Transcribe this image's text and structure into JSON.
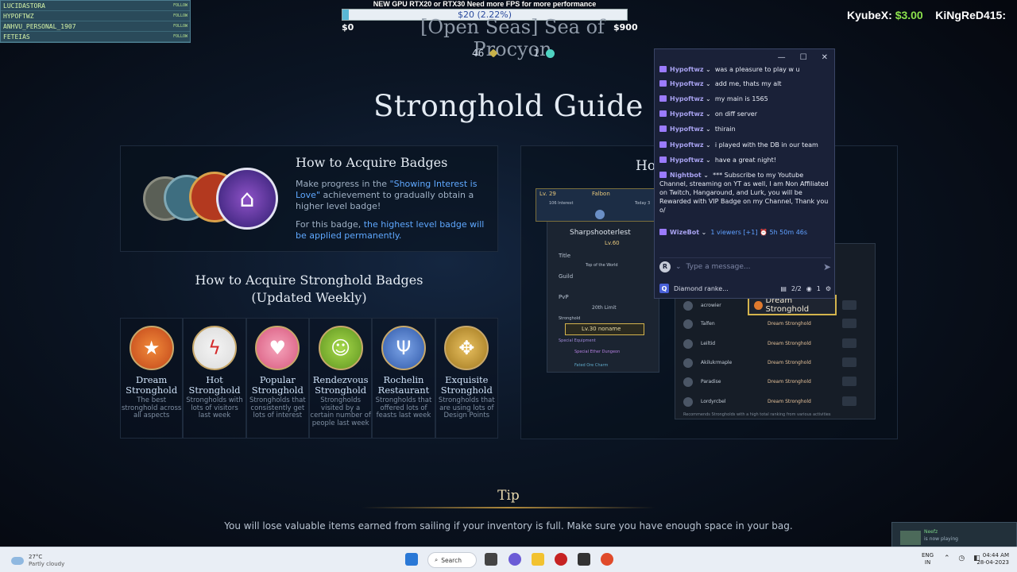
{
  "overlay": {
    "followers": [
      "LUCIDASTORA",
      "HYPOFTWZ",
      "ANHVU_PERSONAL_1907",
      "FETEIAS"
    ],
    "follow_tag": "FOLLOW",
    "goal_text": "NEW GPU RTX20 or RTX30 Need more FPS for more performance",
    "goal_amount": "$20 (2.22%)",
    "goal_progress": 0.0222,
    "goal_min": "$0",
    "goal_max": "$900",
    "donors": [
      {
        "name": "KyubeX:",
        "amount": "$3.00"
      },
      {
        "name": "KiNgReD415:",
        "amount": ""
      }
    ]
  },
  "game": {
    "location": "[Open Seas] Sea of Procyon",
    "currency": {
      "count1": "46",
      "count2": "1"
    },
    "guide_title": "Stronghold Guide",
    "acquire": {
      "title": "How to Acquire Badges",
      "desc_pre": "Make progress in the ",
      "desc_hl": "\"Showing Interest is Love\"",
      "desc_post": " achievement to gradually obtain a higher level badge!",
      "desc2_pre": "For this badge, ",
      "desc2_hl": "the highest level badge will be applied permanently."
    },
    "stronghold_badges_title": "How to Acquire Stronghold Badges",
    "stronghold_badges_subtitle": "(Updated Weekly)",
    "badges": [
      {
        "name": "Dream Stronghold",
        "desc": "The best stronghold across all aspects",
        "icon": "house-star-icon",
        "color": "#d8621e"
      },
      {
        "name": "Hot Stronghold",
        "desc": "Strongholds with lots of visitors last week",
        "icon": "lightning-icon",
        "color": "#cc2b2b"
      },
      {
        "name": "Popular Stronghold",
        "desc": "Strongholds that consistently get lots of interest",
        "icon": "heart-icon",
        "color": "#e06a8c"
      },
      {
        "name": "Rendezvous Stronghold",
        "desc": "Strongholds visited by a certain number of people last week",
        "icon": "people-icon",
        "color": "#6ea326"
      },
      {
        "name": "Rochelin Restaurant",
        "desc": "Strongholds that offered lots of feasts last week",
        "icon": "fork-knife-icon",
        "color": "#3c66b4"
      },
      {
        "name": "Exquisite Stronghold",
        "desc": "Strongholds that are using lots of Design Points",
        "icon": "arrows-icon",
        "color": "#b98a2e"
      }
    ],
    "right_panel_title": "Ho",
    "profile": {
      "level": "Lv. 29",
      "name": "Falbon",
      "interest": "106 Interest",
      "today": "Today 3",
      "char_name": "Sharpshooterlest",
      "char_level": "Lv.60",
      "title_label": "Title",
      "title_value": "Top of the World",
      "guild_label": "Guild",
      "pvp_label": "PvP",
      "pvp_value": "20th Limit",
      "stronghold_label": "Stronghold",
      "stronghold_value": "Lv.30 noname",
      "special_equipment": "Special Equipment",
      "item1": "Special Ether Dungeon",
      "item2": "Fated Ore Charm"
    },
    "list": {
      "rows": [
        {
          "name": "acrowier"
        },
        {
          "name": "Talfen"
        },
        {
          "name": "Leiltid"
        },
        {
          "name": "Akilukrmaple"
        },
        {
          "name": "Paradise"
        },
        {
          "name": "Lordyrcbel"
        }
      ],
      "row_badge": "Dream Stronghold",
      "highlight": "Dream Stronghold",
      "footer": "Recommends Strongholds with a high total ranking from various activities"
    },
    "tip_title": "Tip",
    "tip_text": "You will lose valuable items earned from sailing if your inventory is full. Make sure you have enough space in your bag."
  },
  "chat": {
    "messages": [
      {
        "user": "Hypoftwz",
        "text": "was a pleasure to play w u"
      },
      {
        "user": "Hypoftwz",
        "text": "add me, thats my alt"
      },
      {
        "user": "Hypoftwz",
        "text": "my main is 1565"
      },
      {
        "user": "Hypoftwz",
        "text": "on diff server"
      },
      {
        "user": "Hypoftwz",
        "text": "thirain"
      },
      {
        "user": "Hypoftwz",
        "text": "i played with the DB in our team"
      },
      {
        "user": "Hypoftwz",
        "text": "have a great night!"
      },
      {
        "user": "Nightbot",
        "text": "*** Subscribe to my Youtube Channel, streaming on YT as well, I am Non Affiliated on Twitch, Hangaround, and Lurk, you will be Rewarded with VIP Badge on my Channel, Thank you o/"
      },
      {
        "user": "WizeBot",
        "text": "1 viewers [+1] ⏰ 5h 50m 46s"
      }
    ],
    "input_placeholder": "Type a message...",
    "footer_name": "Diamond ranke...",
    "footer_count": "2/2",
    "footer_viewers": "1"
  },
  "now_playing": {
    "name": "Neefz",
    "text": "is now playing"
  },
  "taskbar": {
    "temp": "27°C",
    "weather": "Partly cloudy",
    "search": "Search",
    "lang1": "ENG",
    "lang2": "IN",
    "time": "04:44 AM",
    "date": "28-04-2023"
  }
}
